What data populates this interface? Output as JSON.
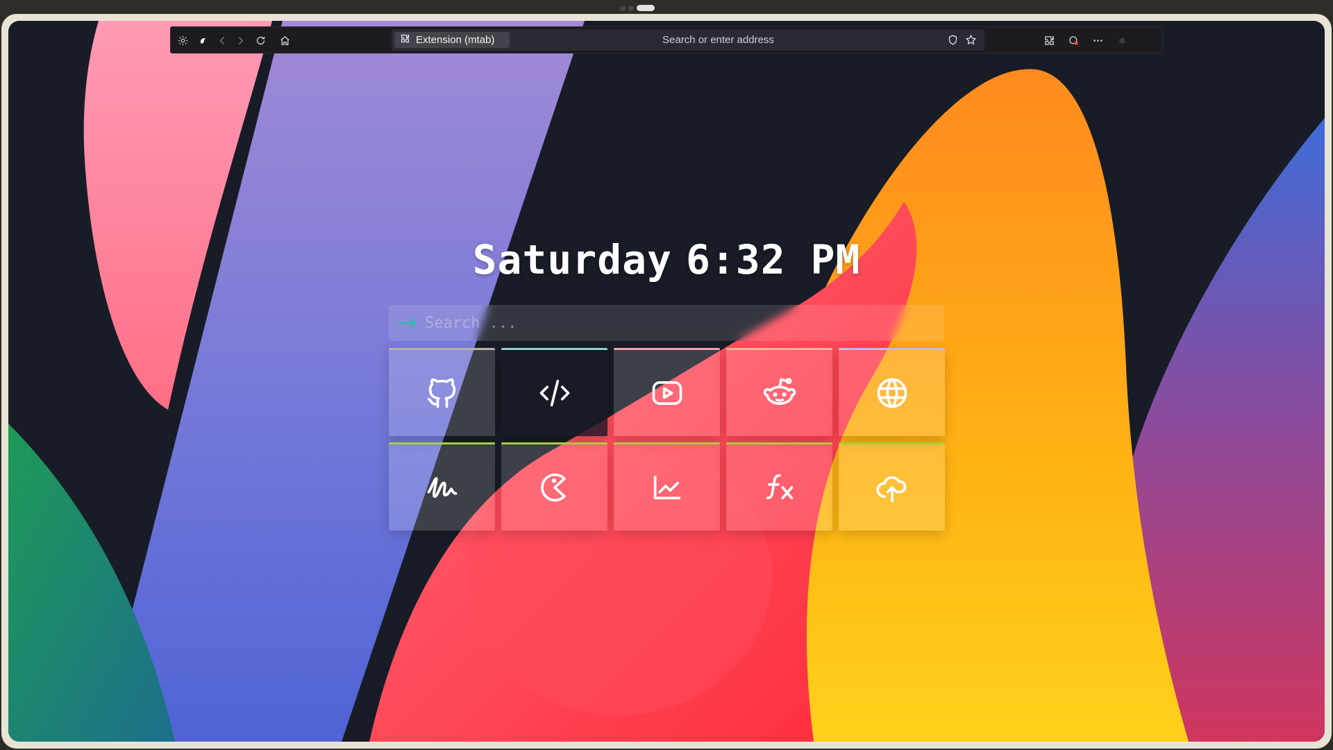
{
  "browser": {
    "tab_label": "Extension (mtab)",
    "address_placeholder": "Search or enter address"
  },
  "icons": {
    "toolbar_left": [
      "settings-icon",
      "profile-icon",
      "back-arrow-icon",
      "forward-arrow-icon",
      "reload-icon",
      "home-icon"
    ],
    "toolbar_right": [
      "extensions-icon",
      "blocker-icon",
      "more-menu-icon",
      "status-dot-icon"
    ],
    "url": [
      "shield-icon",
      "bookmark-star-icon"
    ]
  },
  "clock": {
    "day": "Saturday",
    "time": "6:32 PM"
  },
  "search": {
    "placeholder": "Search ..."
  },
  "tiles": [
    {
      "name": "github",
      "icon": "github-icon",
      "accent": "#b7b0ad"
    },
    {
      "name": "code",
      "icon": "code-icon",
      "accent": "#8fd3d8"
    },
    {
      "name": "youtube",
      "icon": "youtube-icon",
      "accent": "#f2a0b4"
    },
    {
      "name": "reddit",
      "icon": "reddit-icon",
      "accent": "#f2b09a"
    },
    {
      "name": "globe",
      "icon": "globe-icon",
      "accent": "#c6b6e6"
    },
    {
      "name": "scribble",
      "icon": "scribble-icon",
      "accent": "#a8cf3a"
    },
    {
      "name": "pacman",
      "icon": "pacman-icon",
      "accent": "#a8cf3a"
    },
    {
      "name": "chart",
      "icon": "chart-line-icon",
      "accent": "#a8cf3a"
    },
    {
      "name": "function",
      "icon": "function-icon",
      "accent": "#a8cf3a"
    },
    {
      "name": "cloud-upload",
      "icon": "cloud-upload-icon",
      "accent": "#a8cf3a"
    }
  ],
  "colors": {
    "search_arrow": "#2bbfa8",
    "tile_accent_top": "#a8cf3a"
  }
}
